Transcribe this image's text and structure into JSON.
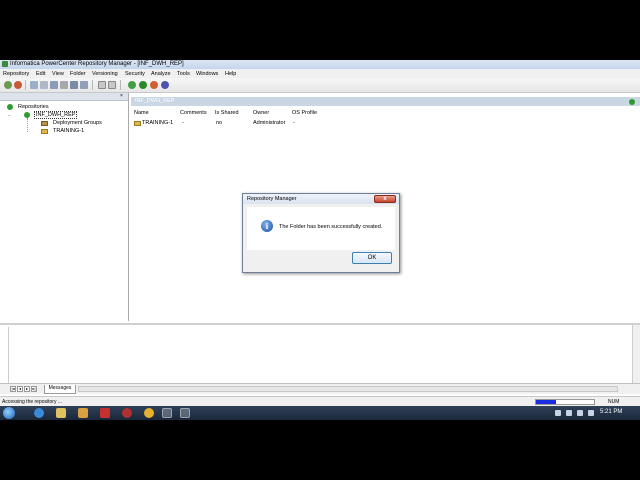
{
  "window": {
    "title": "Informatica PowerCenter Repository Manager - [INF_DWH_REP]"
  },
  "menu": [
    "Repository",
    "Edit",
    "View",
    "Folder",
    "Versioning",
    "Security",
    "Analyze",
    "Tools",
    "Windows",
    "Help"
  ],
  "navigator": {
    "root_label": "Repositories",
    "repo_label": "INF_DWH_REP",
    "items": [
      "Deployment Groups",
      "TRAINING-1"
    ]
  },
  "main": {
    "header_title": "INF_DWH_REP",
    "columns": [
      "Name",
      "Comments",
      "Is Shared",
      "Owner",
      "OS Profile"
    ],
    "rows": [
      {
        "name": "TRAINING-1",
        "comments": "-",
        "shared": "no",
        "owner": "Administrator",
        "os_profile": "-"
      }
    ]
  },
  "output": {
    "tab_label": "Messages"
  },
  "status": {
    "text": "Accessing the repository ...",
    "num_indicator": "NUM",
    "progress": 0.35
  },
  "dialog": {
    "title": "Repository Manager",
    "message": "The Folder has been successfully created.",
    "ok_label": "OK",
    "close_glyph": "x",
    "icon_glyph": "i"
  },
  "taskbar": {
    "clock": "5:21 PM"
  },
  "colors": {
    "progress_fill": "#1a2ee0",
    "repo_green": "#2f9a2f"
  }
}
